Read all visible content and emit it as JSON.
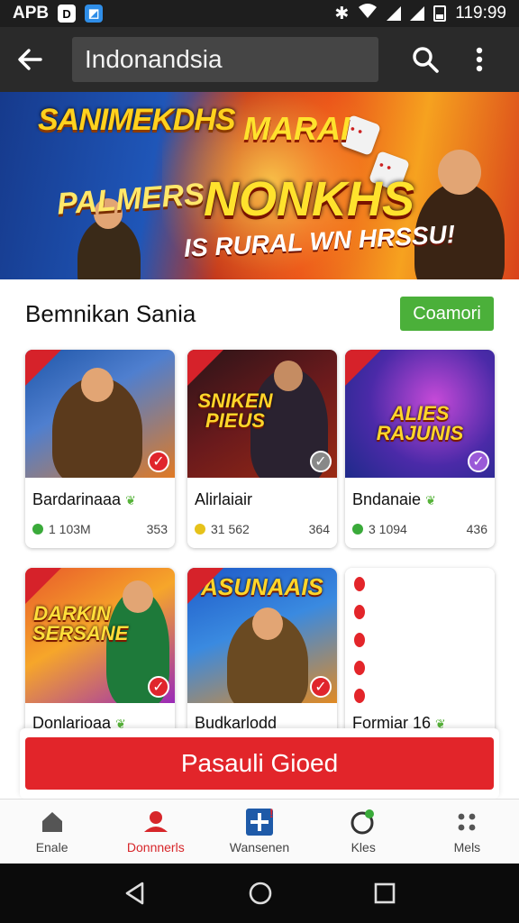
{
  "status_bar": {
    "carrier": "APB",
    "app1": "D",
    "time": "119:99"
  },
  "app_bar": {
    "search_text": "Indonandsia"
  },
  "banner": {
    "left_top": "SANIMEKDHS",
    "left_title": "PALMERS",
    "right_top": "MARAI",
    "right_main": "NONKHS",
    "right_bottom": "IS RURAL WN HRSSU!"
  },
  "section": {
    "title": "Bemnikan Sania",
    "button_label": "Coamori"
  },
  "cards": [
    {
      "title": "Bardarinaaa",
      "downloads": "1 103M",
      "size": "353",
      "thumb_text": "",
      "dot_color": "#3aaa3a"
    },
    {
      "title": "Alirlaiair",
      "downloads": "31 562",
      "size": "364",
      "thumb_text": "SNIKEN PIEUS",
      "dot_color": "#e6c21a"
    },
    {
      "title": "Bndanaie",
      "downloads": "3 1094",
      "size": "436",
      "thumb_text": "ALIES RAJUNIS",
      "dot_color": "#3aaa3a"
    },
    {
      "title": "Donlarioaa",
      "thumb_text": "DARKIN SERSANE"
    },
    {
      "title": "Budkarlodd",
      "thumb_text": "ASUNAAIS"
    },
    {
      "title": "Formiar 16"
    }
  ],
  "cta": {
    "label": "Pasauli Gioed"
  },
  "bottom_nav": [
    {
      "label": "Enale",
      "icon": "home-icon"
    },
    {
      "label": "Donnnerls",
      "icon": "person-icon"
    },
    {
      "label": "Wansenen",
      "icon": "plus-box-icon"
    },
    {
      "label": "Kles",
      "icon": "gamepad-icon"
    },
    {
      "label": "Mels",
      "icon": "more-apps-icon"
    }
  ],
  "colors": {
    "accent_red": "#e2252a",
    "accent_green": "#4bb03a",
    "app_bar": "#2a2a2a"
  }
}
